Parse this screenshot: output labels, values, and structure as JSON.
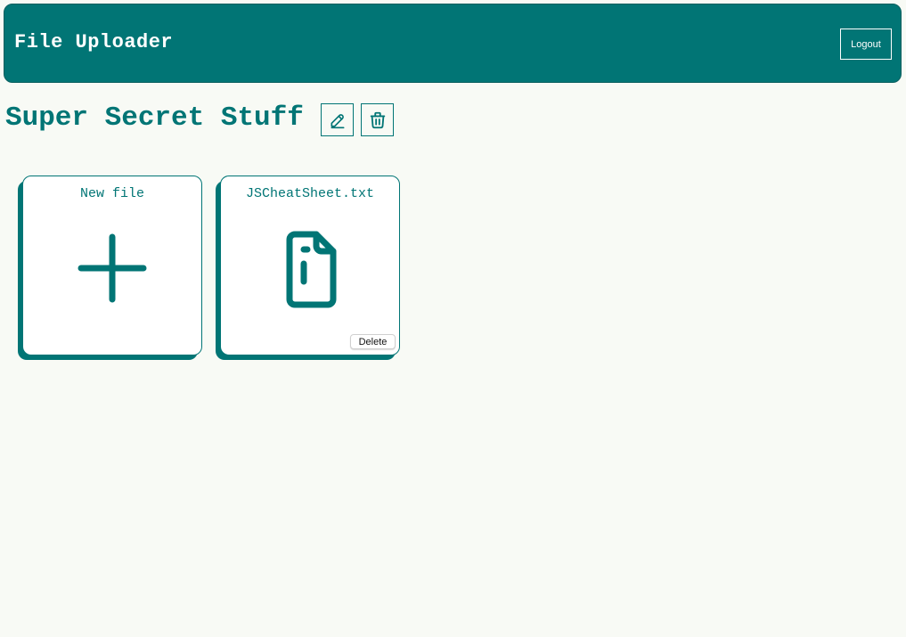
{
  "header": {
    "title": "File Uploader",
    "logout_label": "Logout"
  },
  "folder": {
    "title": "Super Secret Stuff",
    "edit_icon": "pencil-icon",
    "delete_icon": "trash-icon"
  },
  "cards": {
    "new_file": {
      "label": "New file",
      "icon": "plus-icon"
    },
    "file": {
      "label": "JSCheatSheet.txt",
      "icon": "file-text-icon",
      "delete_label": "Delete"
    }
  },
  "colors": {
    "accent": "#017575",
    "background": "#f8faf5",
    "header_text": "#ffffff"
  }
}
